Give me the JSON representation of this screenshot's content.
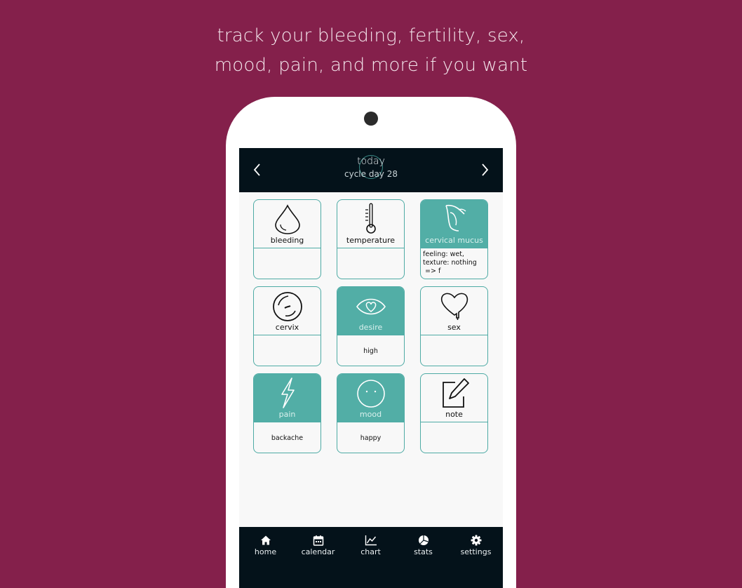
{
  "headline": {
    "line1": "track your bleeding, fertility, sex,",
    "line2": "mood, pain, and more if you want"
  },
  "topbar": {
    "title": "today",
    "subtitle": "cycle day 28",
    "prev_icon": "chevron-left-icon",
    "next_icon": "chevron-right-icon"
  },
  "tiles": [
    {
      "label": "bleeding",
      "icon": "drop-icon",
      "active": false,
      "value": ""
    },
    {
      "label": "temperature",
      "icon": "thermometer-icon",
      "active": false,
      "value": ""
    },
    {
      "label": "cervical mucus",
      "icon": "mucus-icon",
      "active": true,
      "value_lines": [
        "feeling: wet,",
        "texture: nothing",
        " => f"
      ]
    },
    {
      "label": "cervix",
      "icon": "cervix-icon",
      "active": false,
      "value": ""
    },
    {
      "label": "desire",
      "icon": "eye-heart-icon",
      "active": true,
      "value": "high"
    },
    {
      "label": "sex",
      "icon": "heart-icon",
      "active": false,
      "value": ""
    },
    {
      "label": "pain",
      "icon": "lightning-icon",
      "active": true,
      "value": "backache"
    },
    {
      "label": "mood",
      "icon": "face-icon",
      "active": true,
      "value": "happy"
    },
    {
      "label": "note",
      "icon": "pencil-square-icon",
      "active": false,
      "value": ""
    }
  ],
  "bottom_nav": [
    {
      "label": "home",
      "icon": "home-icon"
    },
    {
      "label": "calendar",
      "icon": "calendar-icon"
    },
    {
      "label": "chart",
      "icon": "line-chart-icon"
    },
    {
      "label": "stats",
      "icon": "pie-chart-icon"
    },
    {
      "label": "settings",
      "icon": "gear-icon"
    }
  ],
  "colors": {
    "background": "#84204b",
    "accent": "#52aea6",
    "bar": "#04121a"
  }
}
